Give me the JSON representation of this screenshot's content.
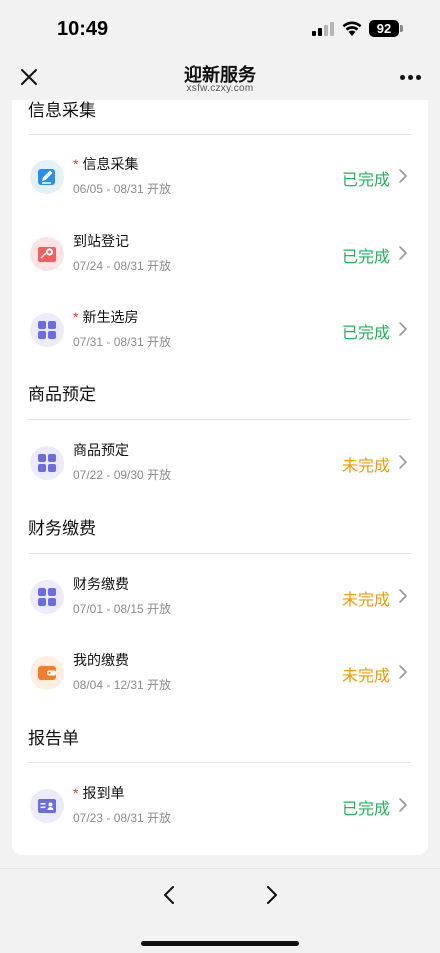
{
  "status_bar": {
    "time": "10:49",
    "battery": "92"
  },
  "nav": {
    "title": "迎新服务",
    "subtitle": "xsfw.czxy.com"
  },
  "sections": [
    {
      "title": "信息采集",
      "items": [
        {
          "name": "信息采集",
          "required": true,
          "date": "06/05 - 08/31 开放",
          "status": "已完成",
          "icon": "edit-icon"
        },
        {
          "name": "到站登记",
          "required": false,
          "date": "07/24 - 08/31 开放",
          "status": "已完成",
          "icon": "map-pin-icon"
        },
        {
          "name": "新生选房",
          "required": true,
          "date": "07/31 - 08/31 开放",
          "status": "已完成",
          "icon": "grid-icon"
        }
      ]
    },
    {
      "title": "商品预定",
      "items": [
        {
          "name": "商品预定",
          "required": false,
          "date": "07/22 - 09/30 开放",
          "status": "未完成",
          "icon": "grid-icon"
        }
      ]
    },
    {
      "title": "财务缴费",
      "items": [
        {
          "name": "财务缴费",
          "required": false,
          "date": "07/01 - 08/15 开放",
          "status": "未完成",
          "icon": "grid-icon"
        },
        {
          "name": "我的缴费",
          "required": false,
          "date": "08/04 - 12/31 开放",
          "status": "未完成",
          "icon": "wallet-icon"
        }
      ]
    },
    {
      "title": "报告单",
      "items": [
        {
          "name": "报到单",
          "required": true,
          "date": "07/23 - 08/31 开放",
          "status": "已完成",
          "icon": "id-card-icon"
        }
      ]
    }
  ],
  "colors": {
    "done": "#1fb35a",
    "todo": "#f29a00",
    "required": "#e53935"
  },
  "icons": {
    "close": "close-icon",
    "more": "more-icon",
    "chevron": "chevron-right-icon",
    "back": "back-arrow-icon",
    "forward": "forward-arrow-icon"
  }
}
